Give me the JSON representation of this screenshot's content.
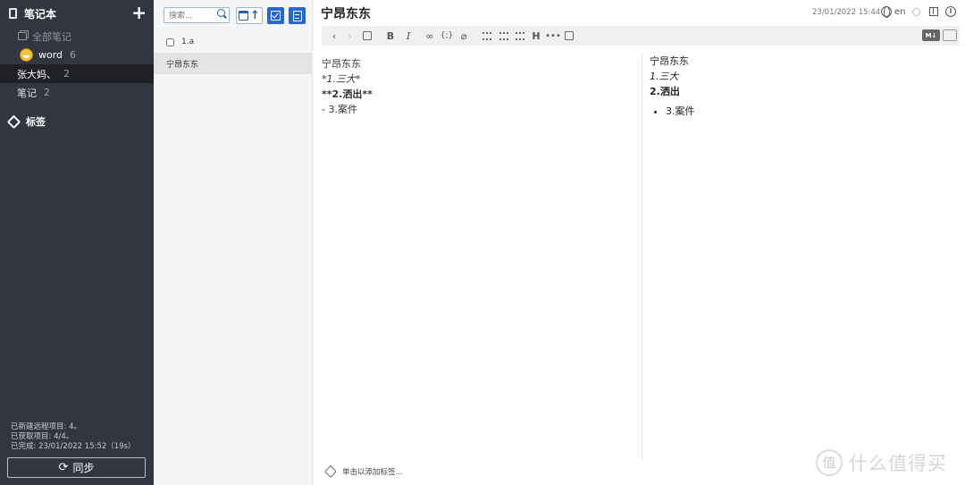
{
  "sidebar": {
    "header": "笔记本",
    "all_notes": "全部笔记",
    "notebooks": [
      {
        "name": "word",
        "count": "6"
      },
      {
        "name": "张大妈、",
        "count": "2"
      },
      {
        "name": "笔记",
        "count": "2"
      }
    ],
    "tags_label": "标签",
    "status": [
      "已新建远程项目: 4。",
      "已获取项目: 4/4。",
      "已完成: 23/01/2022 15:52（19s）"
    ],
    "sync_label": "同步"
  },
  "notelist": {
    "search_placeholder": "搜索...",
    "notes": [
      {
        "title": "1.a",
        "todo": true
      },
      {
        "title": "宁昂东东",
        "todo": false
      }
    ]
  },
  "editor": {
    "title": "宁昂东东",
    "date": "23/01/2022 15:44",
    "language": "en",
    "markdown_badge": "M↓",
    "source_lines": [
      "宁昂东东",
      "*1.三大*",
      "**2.洒出**",
      "- 3.案件"
    ],
    "preview": {
      "line1": "宁昂东东",
      "line2": "1.三大",
      "line3": "2.洒出",
      "list_item": "3.案件"
    },
    "add_tag_hint": "单击以添加标签..."
  },
  "watermark": {
    "circle": "值",
    "text": "什么值得买"
  }
}
